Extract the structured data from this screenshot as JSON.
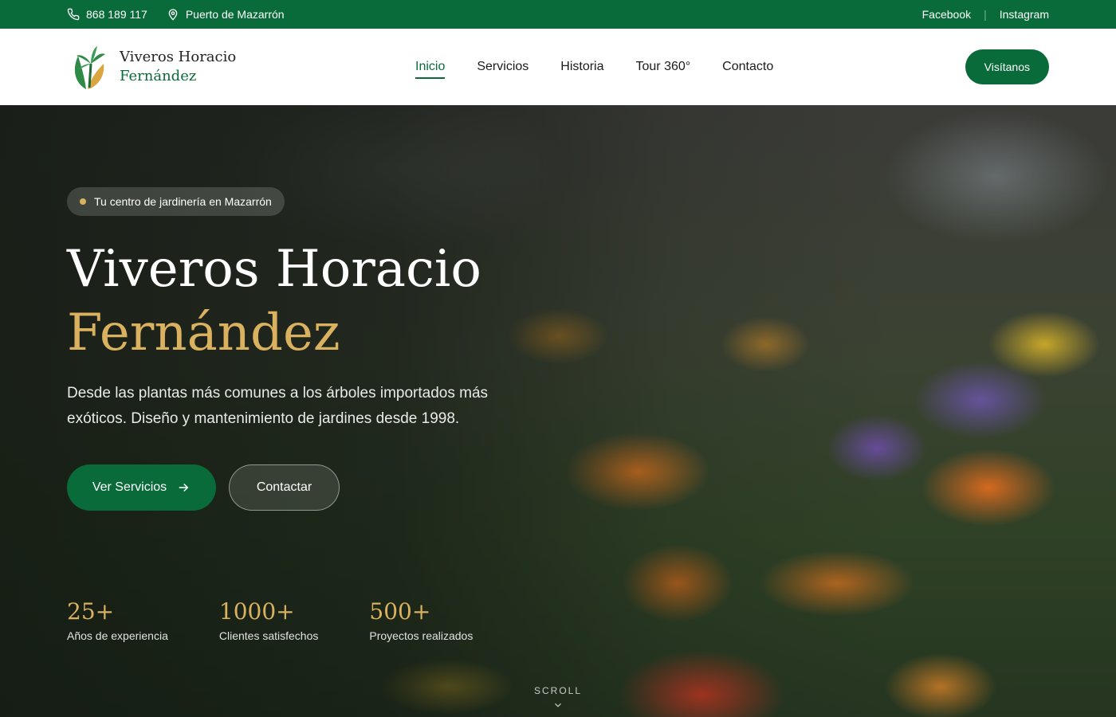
{
  "topbar": {
    "phone": "868 189 117",
    "location": "Puerto de Mazarrón",
    "social": [
      "Facebook",
      "Instagram"
    ],
    "separator": "|"
  },
  "header": {
    "logo_line1": "Viveros Horacio",
    "logo_line2": "Fernández",
    "nav": [
      "Inicio",
      "Servicios",
      "Historia",
      "Tour 360°",
      "Contacto"
    ],
    "active_nav": "Inicio",
    "cta": "Visítanos"
  },
  "hero": {
    "badge": "Tu centro de jardinería en Mazarrón",
    "title_line1": "Viveros Horacio",
    "title_line2": "Fernández",
    "subtitle": "Desde las plantas más comunes a los árboles importados más exóticos. Diseño y mantenimiento de jardines desde 1998.",
    "btn_primary": "Ver Servicios",
    "btn_secondary": "Contactar",
    "stats": [
      {
        "num": "25+",
        "label": "Años de experiencia"
      },
      {
        "num": "1000+",
        "label": "Clientes satisfechos"
      },
      {
        "num": "500+",
        "label": "Proyectos realizados"
      }
    ],
    "scroll": "SCROLL"
  },
  "colors": {
    "brand_green": "#0a6b3a",
    "gold": "#d9b15f"
  }
}
